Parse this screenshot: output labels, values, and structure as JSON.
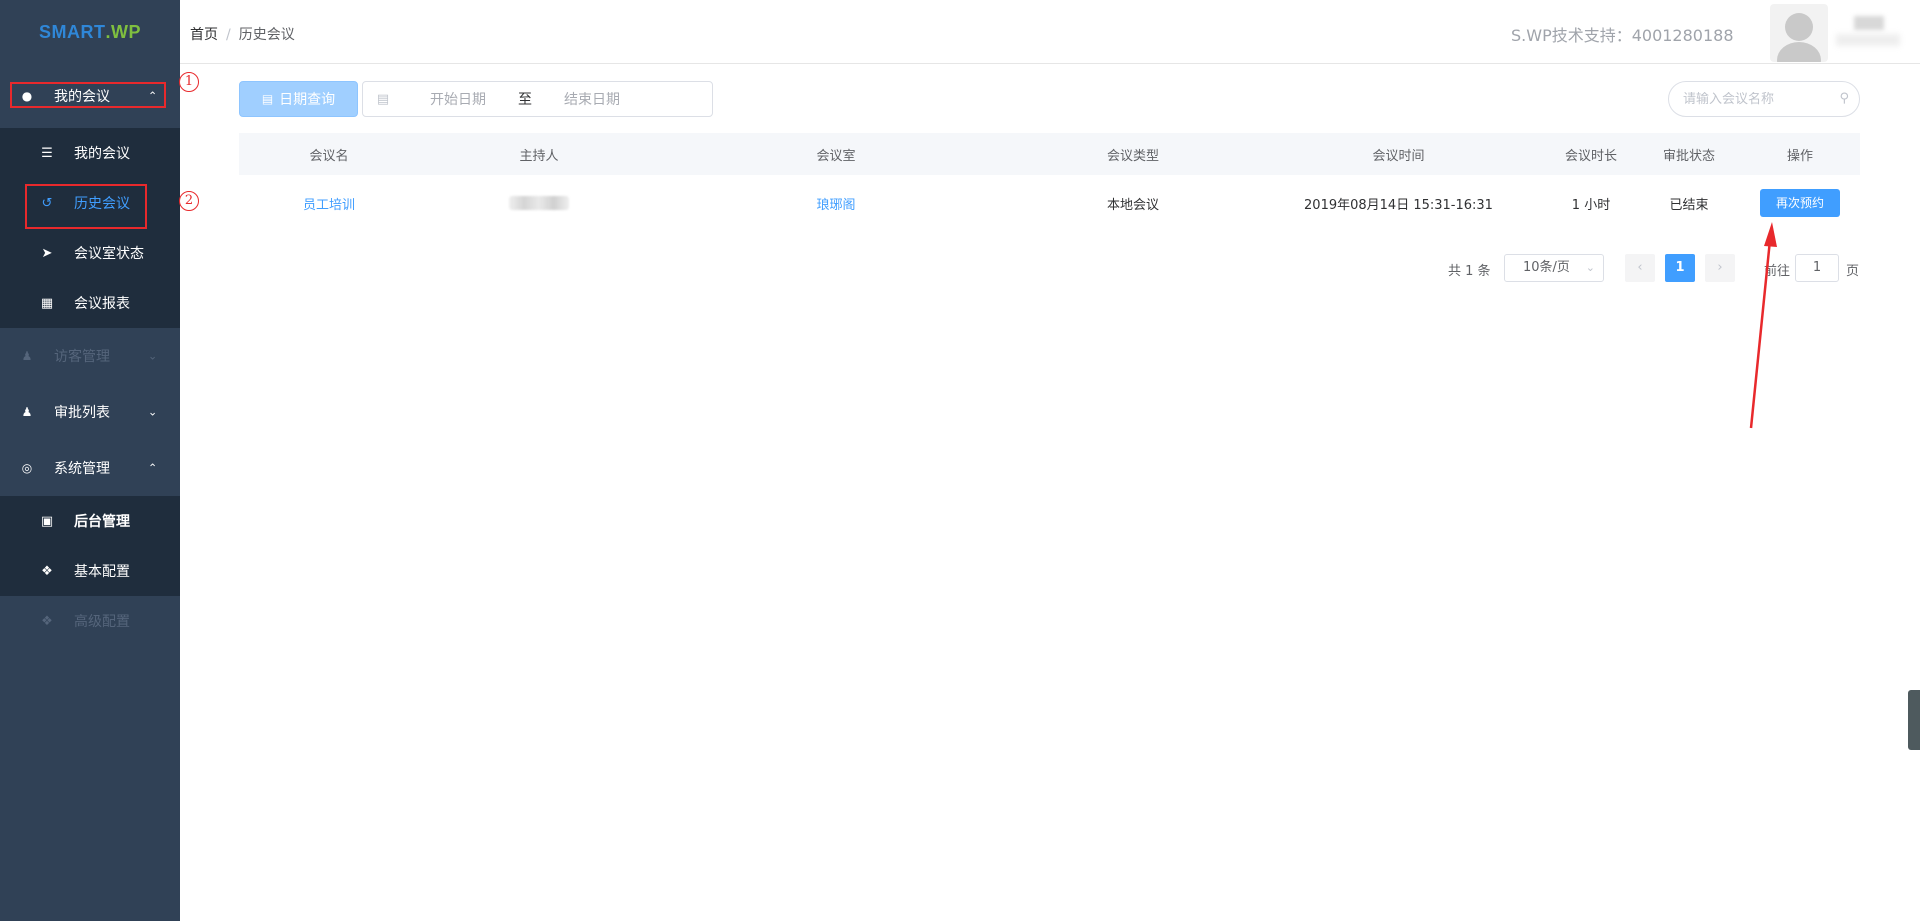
{
  "logo": {
    "part1": "SMART",
    "part2": ".WP"
  },
  "sidebar": {
    "groups": [
      {
        "label": "我的会议",
        "icon": "users-icon",
        "expanded": true,
        "items": [
          {
            "label": "我的会议",
            "icon": "list-icon"
          },
          {
            "label": "历史会议",
            "icon": "history-icon",
            "active": true
          },
          {
            "label": "会议室状态",
            "icon": "send-icon"
          },
          {
            "label": "会议报表",
            "icon": "report-icon"
          }
        ]
      },
      {
        "label": "访客管理",
        "icon": "user-icon",
        "expanded": false,
        "disabled": true
      },
      {
        "label": "审批列表",
        "icon": "user-icon",
        "expanded": false
      },
      {
        "label": "系统管理",
        "icon": "target-icon",
        "expanded": true,
        "items": [
          {
            "label": "后台管理",
            "icon": "image-icon"
          },
          {
            "label": "基本配置",
            "icon": "cube-icon"
          },
          {
            "label": "高级配置",
            "icon": "cube-icon",
            "disabled": true
          }
        ]
      }
    ]
  },
  "annotations": {
    "n1": "1",
    "n2": "2",
    "color": "#e8292c"
  },
  "header": {
    "breadcrumb": {
      "home": "首页",
      "sep": "/",
      "current": "历史会议"
    },
    "support": "S.WP技术支持：4001280188"
  },
  "toolbar": {
    "date_query_label": "日期查询",
    "start_placeholder": "开始日期",
    "range_separator": "至",
    "end_placeholder": "结束日期",
    "search_placeholder": "请输入会议名称"
  },
  "table": {
    "headers": [
      "会议名",
      "主持人",
      "会议室",
      "会议类型",
      "会议时间",
      "会议时长",
      "审批状态",
      "操作"
    ],
    "rows": [
      {
        "name": "员工培训",
        "host": "",
        "room": "琅琊阁",
        "type": "本地会议",
        "time": "2019年08月14日 15:31-16:31",
        "duration": "1 小时",
        "status": "已结束",
        "action": "再次预约"
      }
    ]
  },
  "pagination": {
    "total": "共 1 条",
    "page_size": "10条/页",
    "current_page": "1",
    "goto_prefix": "前往",
    "goto_value": "1",
    "goto_suffix": "页"
  },
  "colors": {
    "sidebar_bg": "#304156",
    "submenu_bg": "#1f2d3d",
    "accent": "#409eff",
    "annotation": "#e8292c"
  }
}
